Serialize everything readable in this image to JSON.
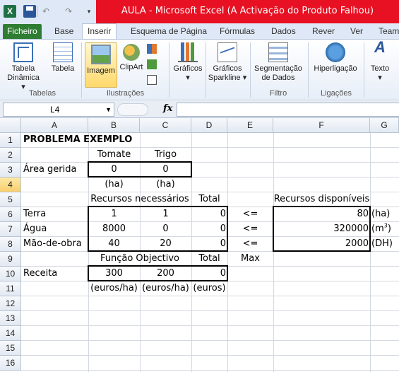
{
  "window": {
    "title": "AULA  -  Microsoft Excel (A Activação do Produto Falhou)",
    "app_icon": "excel-icon",
    "qat": [
      "save-icon",
      "undo-icon",
      "redo-icon",
      "customize-qat-icon"
    ]
  },
  "ribbon_tabs": [
    "Ficheiro",
    "Base",
    "Inserir",
    "Esquema de Página",
    "Fórmulas",
    "Dados",
    "Rever",
    "Ver",
    "Team"
  ],
  "active_tab": "Inserir",
  "ribbon": {
    "groups": {
      "tabelas": "Tabelas",
      "ilustracoes": "Ilustrações",
      "filtro": "Filtro",
      "ligacoes": "Ligações"
    },
    "buttons": {
      "tabela_dinamica_1": "Tabela",
      "tabela_dinamica_2": "Dinâmica",
      "tabela": "Tabela",
      "imagem": "Imagem",
      "clipart": "ClipArt",
      "graficos": "Gráficos",
      "sparkline_1": "Gráficos",
      "sparkline_2": "Sparkline",
      "segmentacao_1": "Segmentação",
      "segmentacao_2": "de Dados",
      "hiperligacao": "Hiperligação",
      "texto": "Texto"
    }
  },
  "formula_bar": {
    "name_box": "L4",
    "fx": "fx",
    "content": ""
  },
  "sheet": {
    "columns": [
      "A",
      "B",
      "C",
      "D",
      "E",
      "F",
      "G"
    ],
    "rows": [
      "1",
      "2",
      "3",
      "4",
      "5",
      "6",
      "7",
      "8",
      "9",
      "10",
      "11",
      "12",
      "13",
      "14",
      "15",
      "16"
    ],
    "active_row": "4",
    "cells": {
      "A1": "PROBLEMA EXEMPLO",
      "B2": "Tomate",
      "C2": "Trigo",
      "A3": "Área gerida",
      "B3": "0",
      "C3": "0",
      "B4": "(ha)",
      "C4": "(ha)",
      "B5": "Recursos necessários",
      "D5": "Total",
      "F5": "Recursos disponíveis",
      "A6": "Terra",
      "B6": "1",
      "C6": "1",
      "D6": "0",
      "E6": "<=",
      "F6": "80",
      "G6": "(ha)",
      "A7": "Água",
      "B7": "8000",
      "C7": "0",
      "D7": "0",
      "E7": "<=",
      "F7": "320000",
      "G7_pre": "(m",
      "G7_sup": "3",
      "G7_post": ")",
      "A8": "Mão-de-obra",
      "B8": "40",
      "C8": "20",
      "D8": "0",
      "E8": "<=",
      "F8": "2000",
      "G8": "(DH)",
      "B9": "Função Objectivo",
      "D9": "Total",
      "E9": "Max",
      "A10": "Receita",
      "B10": "300",
      "C10": "200",
      "D10": "0",
      "B11": "(euros/ha)",
      "C11": "(euros/ha)",
      "D11": "(euros)"
    }
  }
}
